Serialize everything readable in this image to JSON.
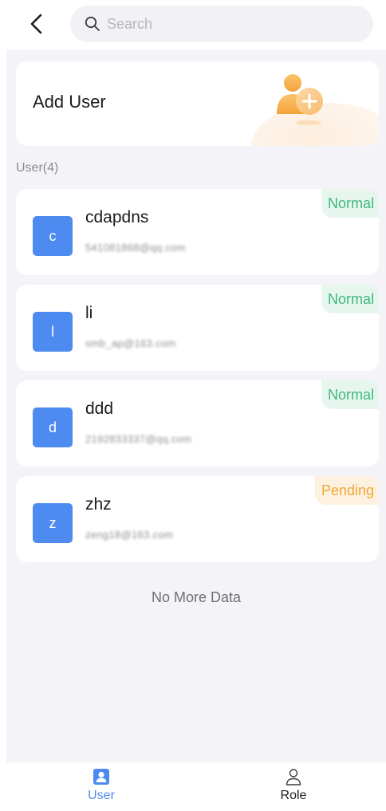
{
  "search": {
    "placeholder": "Search"
  },
  "add_user": {
    "label": "Add User"
  },
  "section": {
    "title": "User(4)"
  },
  "users": [
    {
      "initial": "c",
      "name": "cdapdns",
      "email": "541081868@qq.com",
      "status": "Normal"
    },
    {
      "initial": "l",
      "name": "li",
      "email": "smb_ap@163.com",
      "status": "Normal"
    },
    {
      "initial": "d",
      "name": "ddd",
      "email": "2192833337@qq.com",
      "status": "Normal"
    },
    {
      "initial": "z",
      "name": "zhz",
      "email": "zeng18@163.com",
      "status": "Pending"
    }
  ],
  "footer": {
    "no_more": "No More Data"
  },
  "tabs": [
    {
      "label": "User",
      "active": true,
      "icon": "user-card-icon"
    },
    {
      "label": "Role",
      "active": false,
      "icon": "person-outline-icon"
    }
  ],
  "colors": {
    "accent": "#4e8bf0",
    "normal": "#3fb77b",
    "pending": "#f0a838",
    "background": "#f4f4f8"
  }
}
